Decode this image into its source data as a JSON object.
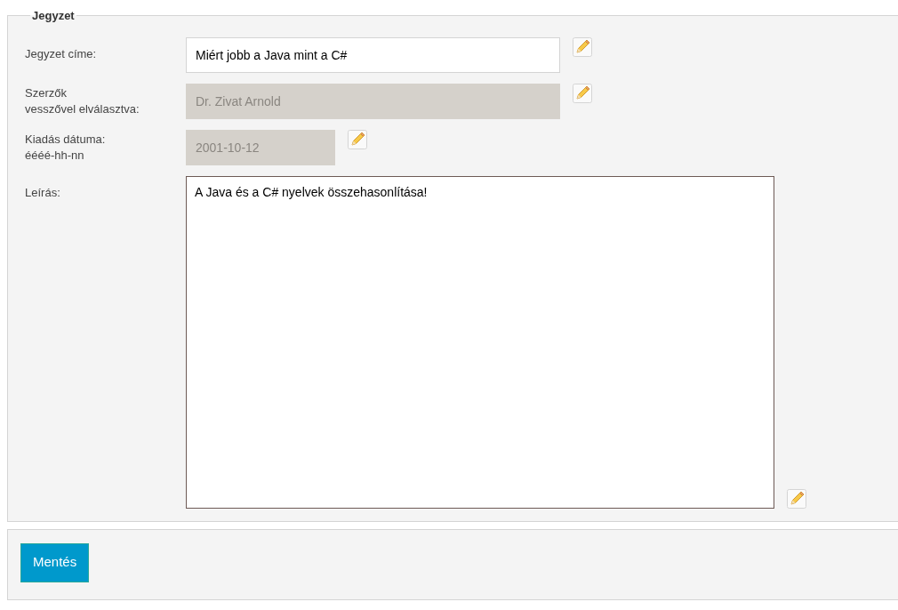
{
  "fieldset": {
    "legend": "Jegyzet",
    "fields": [
      {
        "kind": "text",
        "label": "Jegyzet címe:",
        "value": "Miért jobb a Java mint a C#",
        "disabled": false
      },
      {
        "kind": "text",
        "label": "Szerzők\nvesszővel elválasztva:",
        "value": "Dr. Zivat Arnold",
        "disabled": true
      },
      {
        "kind": "date",
        "label": "Kiadás dátuma:\néééé-hh-nn",
        "value": "2001-10-12",
        "disabled": true
      },
      {
        "kind": "textarea",
        "label": "Leírás:",
        "value": "A Java és a C# nyelvek összehasonlítása!",
        "disabled": false
      }
    ]
  },
  "save_button": "Mentés"
}
